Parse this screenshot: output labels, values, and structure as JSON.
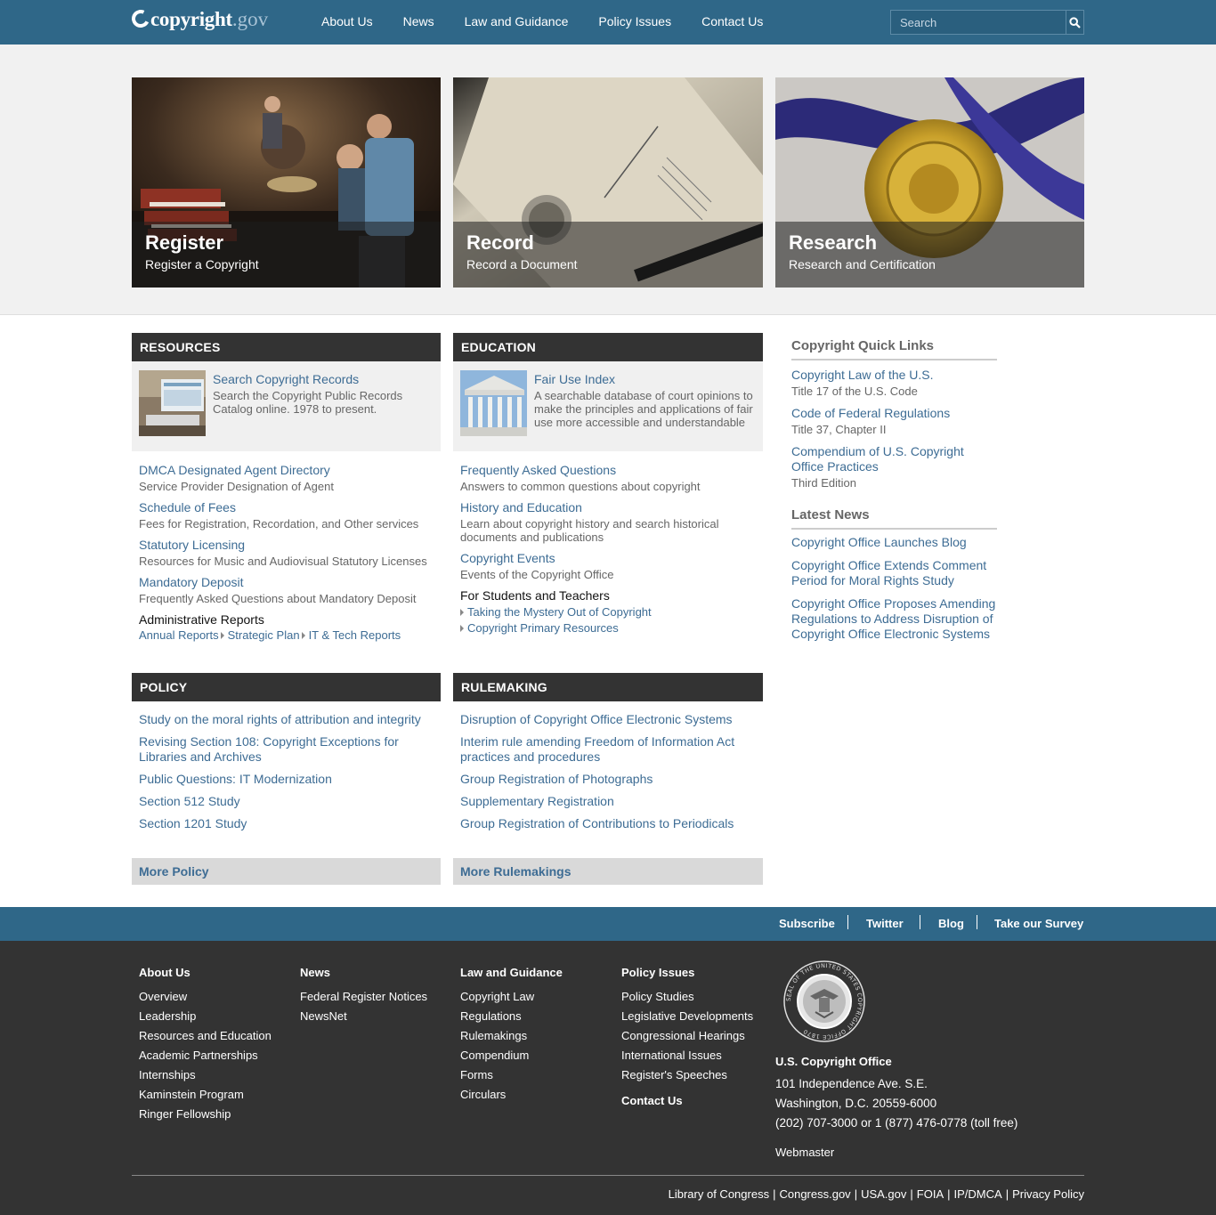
{
  "header": {
    "logo_word": "copyright",
    "logo_suffix": ".gov",
    "nav": [
      "About Us",
      "News",
      "Law and Guidance",
      "Policy Issues",
      "Contact Us"
    ],
    "search_placeholder": "Search"
  },
  "hero": [
    {
      "title": "Register",
      "subtitle": "Register a Copyright"
    },
    {
      "title": "Record",
      "subtitle": "Record a Document"
    },
    {
      "title": "Research",
      "subtitle": "Research and Certification"
    }
  ],
  "resources": {
    "heading": "RESOURCES",
    "featured": {
      "title": "Search Copyright Records",
      "desc": "Search the Copyright Public Records Catalog online. 1978 to present."
    },
    "items": [
      {
        "title": "DMCA Designated Agent Directory",
        "desc": "Service Provider Designation of Agent"
      },
      {
        "title": "Schedule of Fees",
        "desc": "Fees for Registration, Recordation, and Other services"
      },
      {
        "title": "Statutory Licensing",
        "desc": "Resources for Music and Audiovisual Statutory Licenses"
      },
      {
        "title": "Mandatory Deposit",
        "desc": "Frequently Asked Questions about Mandatory Deposit"
      }
    ],
    "admin_heading": "Administrative Reports",
    "admin_links": [
      "Annual Reports",
      "Strategic Plan",
      "IT & Tech Reports"
    ]
  },
  "education": {
    "heading": "EDUCATION",
    "featured": {
      "title": "Fair Use Index",
      "desc": "A searchable database of court opinions to make the principles and applications of fair use more accessible and understandable"
    },
    "items": [
      {
        "title": "Frequently Asked Questions",
        "desc": "Answers to common questions about copyright"
      },
      {
        "title": "History and Education",
        "desc": "Learn about copyright history and search historical documents and publications"
      },
      {
        "title": "Copyright Events",
        "desc": "Events of the Copyright Office"
      }
    ],
    "students_heading": "For Students and Teachers",
    "students_links": [
      "Taking the Mystery Out of Copyright",
      "Copyright Primary Resources"
    ]
  },
  "policy": {
    "heading": "POLICY",
    "links": [
      "Study on the moral rights of attribution and integrity",
      "Revising Section 108: Copyright Exceptions for Libraries and Archives",
      "Public Questions: IT Modernization",
      "Section 512 Study",
      "Section 1201 Study"
    ],
    "more": "More Policy"
  },
  "rulemaking": {
    "heading": "RULEMAKING",
    "links": [
      "Disruption of Copyright Office Electronic Systems",
      "Interim rule amending Freedom of Information Act practices and procedures",
      "Group Registration of Photographs",
      "Supplementary Registration",
      "Group Registration of Contributions to Periodicals"
    ],
    "more": "More Rulemakings"
  },
  "quick_links": {
    "heading": "Copyright Quick Links",
    "items": [
      {
        "title": "Copyright Law of the U.S.",
        "desc": "Title 17 of the U.S. Code"
      },
      {
        "title": "Code of Federal Regulations",
        "desc": "Title 37, Chapter II"
      },
      {
        "title": "Compendium of U.S. Copyright Office Practices",
        "desc": "Third Edition"
      }
    ]
  },
  "latest_news": {
    "heading": "Latest News",
    "items": [
      "Copyright Office Launches Blog",
      "Copyright Office Extends Comment Period for Moral Rights Study",
      "Copyright Office Proposes Amending Regulations to Address Disruption of Copyright Office Electronic Systems"
    ]
  },
  "footer_bar": [
    "Subscribe",
    "Twitter",
    "Blog",
    "Take our Survey"
  ],
  "footer": {
    "about": {
      "heading": "About Us",
      "items": [
        "Overview",
        "Leadership",
        "Resources and Education",
        "Academic Partnerships",
        "Internships",
        "Kaminstein Program",
        "Ringer Fellowship"
      ]
    },
    "news": {
      "heading": "News",
      "items": [
        "Federal Register Notices",
        "NewsNet"
      ]
    },
    "law": {
      "heading": "Law and Guidance",
      "items": [
        "Copyright Law",
        "Regulations",
        "Rulemakings",
        "Compendium",
        "Forms",
        "Circulars"
      ]
    },
    "policy": {
      "heading": "Policy Issues",
      "items": [
        "Policy Studies",
        "Legislative Developments",
        "Congressional Hearings",
        "International Issues",
        "Register's Speeches"
      ]
    },
    "contact": "Contact Us",
    "seal_text": "SEAL OF THE UNITED STATES COPYRIGHT OFFICE 1870",
    "office": "U.S. Copyright Office",
    "address1": "101 Independence Ave. S.E.",
    "address2": "Washington, D.C. 20559-6000",
    "phone": "(202) 707-3000 or 1 (877) 476-0778 (toll free)",
    "webmaster": "Webmaster",
    "bottom_links": [
      "Library of Congress",
      "Congress.gov",
      "USA.gov",
      "FOIA",
      "IP/DMCA",
      "Privacy Policy"
    ]
  },
  "colors": {
    "header": "#2f6788",
    "link": "#3d6c94",
    "panel_head": "#333333",
    "footer": "#333333"
  }
}
